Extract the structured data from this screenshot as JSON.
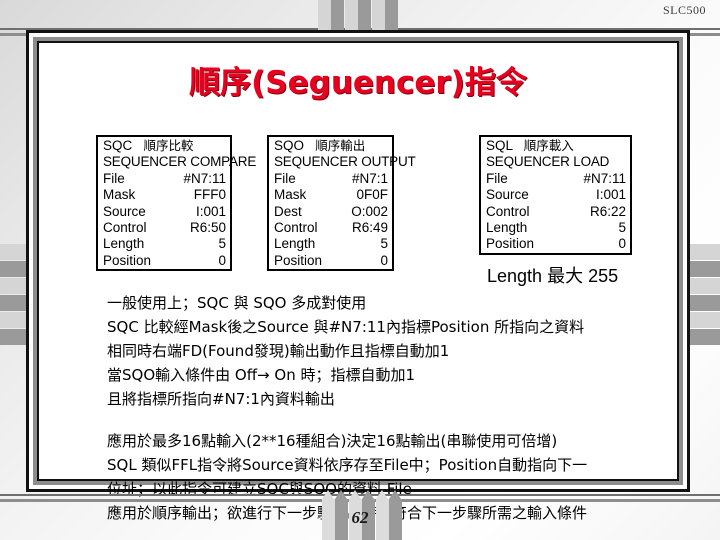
{
  "header": {
    "corner_label": "SLC500"
  },
  "slide": {
    "title": "順序(Seguencer)指令",
    "title_color": "#e8001f",
    "page_number": "62"
  },
  "boxes": [
    {
      "id": "sqc",
      "head_code": "SQC",
      "head_cjk": "順序比較",
      "subtitle": "SEQUENCER COMPARE",
      "rows": [
        {
          "key": "File",
          "value": "#N7:11"
        },
        {
          "key": "Mask",
          "value": "FFF0"
        },
        {
          "key": "Source",
          "value": "I:001"
        },
        {
          "key": "Control",
          "value": "R6:50"
        },
        {
          "key": "Length",
          "value": "5"
        },
        {
          "key": "Position",
          "value": "0"
        }
      ]
    },
    {
      "id": "sqo",
      "head_code": "SQO",
      "head_cjk": "順序輸出",
      "subtitle": "SEQUENCER OUTPUT",
      "rows": [
        {
          "key": "File",
          "value": "#N7:1"
        },
        {
          "key": "Mask",
          "value": "0F0F"
        },
        {
          "key": "Dest",
          "value": "O:002"
        },
        {
          "key": "Control",
          "value": "R6:49"
        },
        {
          "key": "Length",
          "value": "5"
        },
        {
          "key": "Position",
          "value": "0"
        }
      ]
    },
    {
      "id": "sql",
      "head_code": "SQL",
      "head_cjk": "順序載入",
      "subtitle": "SEQUENCER LOAD",
      "rows": [
        {
          "key": "File",
          "value": "#N7:11"
        },
        {
          "key": "Source",
          "value": "I:001"
        },
        {
          "key": "Control",
          "value": "R6:22"
        },
        {
          "key": "Length",
          "value": "5"
        },
        {
          "key": "Position",
          "value": "0"
        }
      ]
    }
  ],
  "length_max": {
    "label": "Length",
    "cjk": "最大",
    "value": "255"
  },
  "paragraph_top": {
    "lines": [
      "一般使用上；SQC 與 SQO 多成對使用",
      "SQC 比較經Mask後之Source 與#N7:11內指標Position 所指向之資料",
      "相同時右端FD(Found發現)輸出動作且指標自動加1",
      "當SQO輸入條件由 Off→ On 時；指標自動加1",
      "且將指標所指向#N7:1內資料輸出"
    ]
  },
  "paragraph_bottom": {
    "lines": [
      "應用於最多16點輸入(2**16種組合)決定16點輸出(串聯使用可倍增)",
      "SQL 類似FFL指令將Source資料依序存至File中；Position自動指向下一",
      "位址；以此指令可建立SQC與SQO的資料 File",
      "應用於順序輸出；欲進行下一步驟輸出時須符合下一步驟所需之輸入條件"
    ]
  },
  "decor": {
    "bar_light": "#d5d5d5",
    "bar_dark": "#9a9a9a",
    "rule_dark": "#6f6f6f",
    "rule_mid": "#8d8d8d"
  }
}
